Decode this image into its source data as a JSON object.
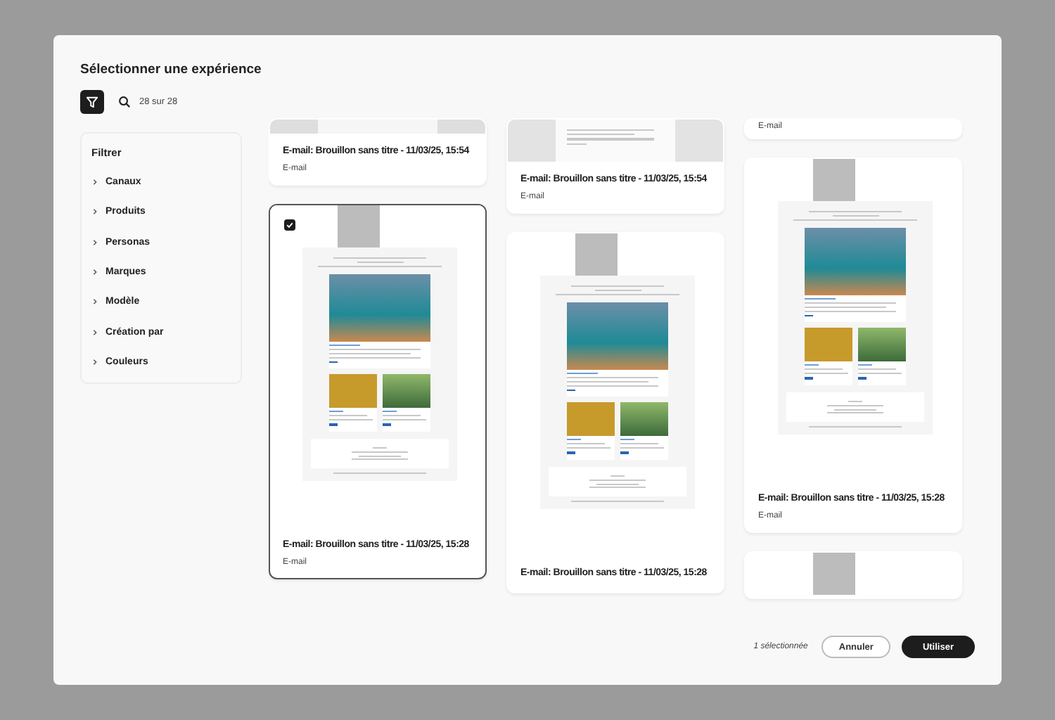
{
  "dialog": {
    "title": "Sélectionner une expérience"
  },
  "toolbar": {
    "count": "28 sur 28",
    "filter_active": true
  },
  "filters": {
    "heading": "Filtrer",
    "items": [
      {
        "label": "Canaux",
        "expanded": false
      },
      {
        "label": "Produits",
        "expanded": false
      },
      {
        "label": "Personas",
        "expanded": false
      },
      {
        "label": "Marques",
        "expanded": false
      },
      {
        "label": "Modèle",
        "expanded": false
      },
      {
        "label": "Création par",
        "expanded": false
      },
      {
        "label": "Couleurs",
        "expanded": false
      }
    ]
  },
  "columns": [
    {
      "cards": [
        {
          "kind": "strip",
          "title": "E-mail: Brouillon sans titre - 11/03/25, 15:54",
          "subtitle": "E-mail",
          "selected": false
        },
        {
          "kind": "email",
          "title": "E-mail: Brouillon sans titre - 11/03/25, 15:28",
          "subtitle": "E-mail",
          "selected": true
        }
      ]
    },
    {
      "cards": [
        {
          "kind": "text",
          "title": "E-mail: Brouillon sans titre - 11/03/25, 15:54",
          "subtitle": "E-mail",
          "selected": false
        },
        {
          "kind": "email",
          "title": "E-mail: Brouillon sans titre - 11/03/25, 15:28",
          "selected": false
        }
      ]
    },
    {
      "cards": [
        {
          "kind": "none",
          "subtitle": "E-mail",
          "selected": false
        },
        {
          "kind": "email",
          "title": "E-mail: Brouillon sans titre - 11/03/25, 15:28",
          "subtitle": "E-mail",
          "selected": false
        },
        {
          "kind": "email-top",
          "selected": false
        }
      ]
    }
  ],
  "footer": {
    "selection": "1 sélectionnée",
    "buttons": [
      {
        "label": "Annuler",
        "kind": "secondary"
      },
      {
        "label": "Utiliser",
        "kind": "primary"
      }
    ]
  }
}
